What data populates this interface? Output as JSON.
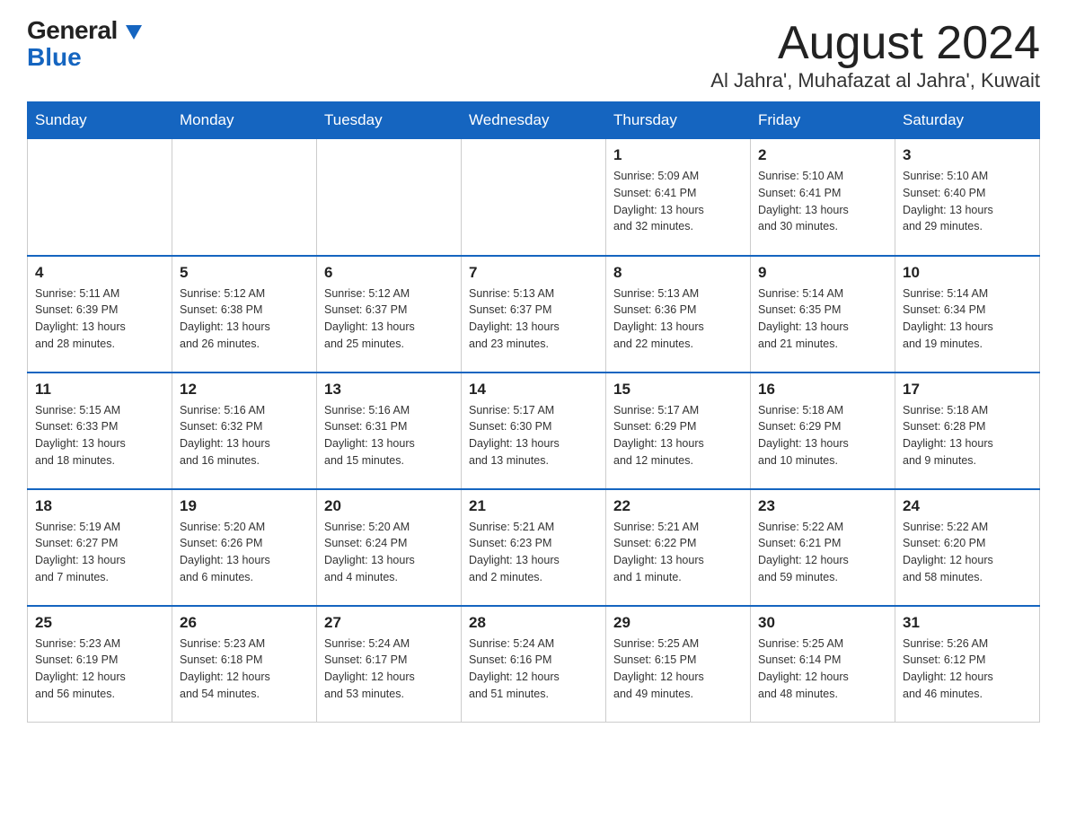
{
  "logo": {
    "general": "General",
    "blue": "Blue",
    "arrow": "▼"
  },
  "title": {
    "month": "August 2024",
    "location": "Al Jahra', Muhafazat al Jahra', Kuwait"
  },
  "days_header": [
    "Sunday",
    "Monday",
    "Tuesday",
    "Wednesday",
    "Thursday",
    "Friday",
    "Saturday"
  ],
  "weeks": [
    [
      {
        "day": "",
        "info": ""
      },
      {
        "day": "",
        "info": ""
      },
      {
        "day": "",
        "info": ""
      },
      {
        "day": "",
        "info": ""
      },
      {
        "day": "1",
        "info": "Sunrise: 5:09 AM\nSunset: 6:41 PM\nDaylight: 13 hours\nand 32 minutes."
      },
      {
        "day": "2",
        "info": "Sunrise: 5:10 AM\nSunset: 6:41 PM\nDaylight: 13 hours\nand 30 minutes."
      },
      {
        "day": "3",
        "info": "Sunrise: 5:10 AM\nSunset: 6:40 PM\nDaylight: 13 hours\nand 29 minutes."
      }
    ],
    [
      {
        "day": "4",
        "info": "Sunrise: 5:11 AM\nSunset: 6:39 PM\nDaylight: 13 hours\nand 28 minutes."
      },
      {
        "day": "5",
        "info": "Sunrise: 5:12 AM\nSunset: 6:38 PM\nDaylight: 13 hours\nand 26 minutes."
      },
      {
        "day": "6",
        "info": "Sunrise: 5:12 AM\nSunset: 6:37 PM\nDaylight: 13 hours\nand 25 minutes."
      },
      {
        "day": "7",
        "info": "Sunrise: 5:13 AM\nSunset: 6:37 PM\nDaylight: 13 hours\nand 23 minutes."
      },
      {
        "day": "8",
        "info": "Sunrise: 5:13 AM\nSunset: 6:36 PM\nDaylight: 13 hours\nand 22 minutes."
      },
      {
        "day": "9",
        "info": "Sunrise: 5:14 AM\nSunset: 6:35 PM\nDaylight: 13 hours\nand 21 minutes."
      },
      {
        "day": "10",
        "info": "Sunrise: 5:14 AM\nSunset: 6:34 PM\nDaylight: 13 hours\nand 19 minutes."
      }
    ],
    [
      {
        "day": "11",
        "info": "Sunrise: 5:15 AM\nSunset: 6:33 PM\nDaylight: 13 hours\nand 18 minutes."
      },
      {
        "day": "12",
        "info": "Sunrise: 5:16 AM\nSunset: 6:32 PM\nDaylight: 13 hours\nand 16 minutes."
      },
      {
        "day": "13",
        "info": "Sunrise: 5:16 AM\nSunset: 6:31 PM\nDaylight: 13 hours\nand 15 minutes."
      },
      {
        "day": "14",
        "info": "Sunrise: 5:17 AM\nSunset: 6:30 PM\nDaylight: 13 hours\nand 13 minutes."
      },
      {
        "day": "15",
        "info": "Sunrise: 5:17 AM\nSunset: 6:29 PM\nDaylight: 13 hours\nand 12 minutes."
      },
      {
        "day": "16",
        "info": "Sunrise: 5:18 AM\nSunset: 6:29 PM\nDaylight: 13 hours\nand 10 minutes."
      },
      {
        "day": "17",
        "info": "Sunrise: 5:18 AM\nSunset: 6:28 PM\nDaylight: 13 hours\nand 9 minutes."
      }
    ],
    [
      {
        "day": "18",
        "info": "Sunrise: 5:19 AM\nSunset: 6:27 PM\nDaylight: 13 hours\nand 7 minutes."
      },
      {
        "day": "19",
        "info": "Sunrise: 5:20 AM\nSunset: 6:26 PM\nDaylight: 13 hours\nand 6 minutes."
      },
      {
        "day": "20",
        "info": "Sunrise: 5:20 AM\nSunset: 6:24 PM\nDaylight: 13 hours\nand 4 minutes."
      },
      {
        "day": "21",
        "info": "Sunrise: 5:21 AM\nSunset: 6:23 PM\nDaylight: 13 hours\nand 2 minutes."
      },
      {
        "day": "22",
        "info": "Sunrise: 5:21 AM\nSunset: 6:22 PM\nDaylight: 13 hours\nand 1 minute."
      },
      {
        "day": "23",
        "info": "Sunrise: 5:22 AM\nSunset: 6:21 PM\nDaylight: 12 hours\nand 59 minutes."
      },
      {
        "day": "24",
        "info": "Sunrise: 5:22 AM\nSunset: 6:20 PM\nDaylight: 12 hours\nand 58 minutes."
      }
    ],
    [
      {
        "day": "25",
        "info": "Sunrise: 5:23 AM\nSunset: 6:19 PM\nDaylight: 12 hours\nand 56 minutes."
      },
      {
        "day": "26",
        "info": "Sunrise: 5:23 AM\nSunset: 6:18 PM\nDaylight: 12 hours\nand 54 minutes."
      },
      {
        "day": "27",
        "info": "Sunrise: 5:24 AM\nSunset: 6:17 PM\nDaylight: 12 hours\nand 53 minutes."
      },
      {
        "day": "28",
        "info": "Sunrise: 5:24 AM\nSunset: 6:16 PM\nDaylight: 12 hours\nand 51 minutes."
      },
      {
        "day": "29",
        "info": "Sunrise: 5:25 AM\nSunset: 6:15 PM\nDaylight: 12 hours\nand 49 minutes."
      },
      {
        "day": "30",
        "info": "Sunrise: 5:25 AM\nSunset: 6:14 PM\nDaylight: 12 hours\nand 48 minutes."
      },
      {
        "day": "31",
        "info": "Sunrise: 5:26 AM\nSunset: 6:12 PM\nDaylight: 12 hours\nand 46 minutes."
      }
    ]
  ]
}
